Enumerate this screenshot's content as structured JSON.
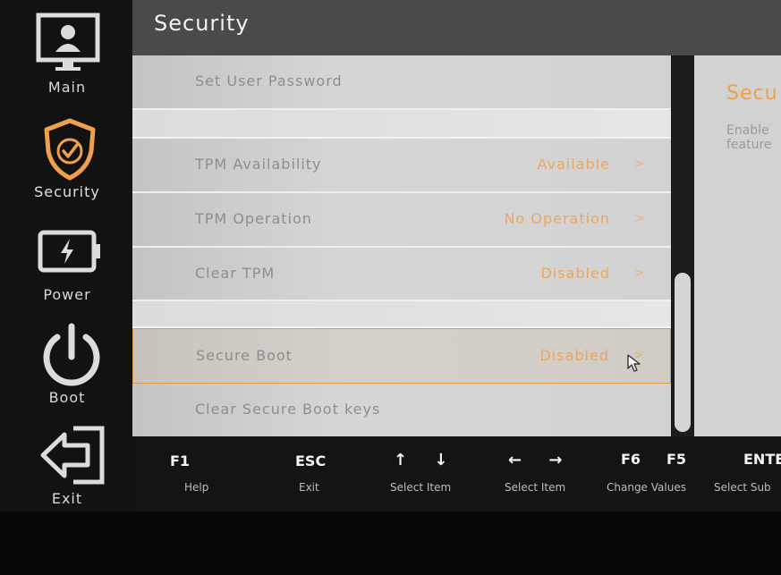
{
  "header": {
    "title": "Security"
  },
  "sidebar": {
    "items": [
      {
        "label": "Main",
        "icon": "monitor-user-icon"
      },
      {
        "label": "Security",
        "icon": "shield-check-icon",
        "active": true
      },
      {
        "label": "Power",
        "icon": "battery-icon"
      },
      {
        "label": "Boot",
        "icon": "power-icon"
      },
      {
        "label": "Exit",
        "icon": "exit-arrow-icon"
      }
    ]
  },
  "settings": [
    {
      "label": "Set User Password",
      "value": ""
    },
    {
      "label": "TPM Availability",
      "value": "Available"
    },
    {
      "label": "TPM Operation",
      "value": "No Operation"
    },
    {
      "label": "Clear TPM",
      "value": "Disabled"
    },
    {
      "label": "Secure Boot",
      "value": "Disabled",
      "selected": true
    },
    {
      "label": "Clear Secure Boot keys",
      "value": ""
    }
  ],
  "chevron": ">",
  "help": {
    "title": "Secu",
    "description_line1": "Enable",
    "description_line2": "feature"
  },
  "hints": [
    {
      "key": "F1",
      "desc": "Help"
    },
    {
      "key": "ESC",
      "desc": "Exit"
    },
    {
      "key": "↑ ↓",
      "desc": "Select Item"
    },
    {
      "key": "← →",
      "desc": "Select Item"
    },
    {
      "key": "F6",
      "desc": "Change Values"
    },
    {
      "key": "F5",
      "desc": ""
    },
    {
      "key": "ENTER",
      "desc": "Select Sub"
    }
  ],
  "colors": {
    "accent": "#f0a04a",
    "header_bg": "#4a4a4a",
    "sidebar_bg": "#121212",
    "row_bg": "#d2d2d2"
  }
}
